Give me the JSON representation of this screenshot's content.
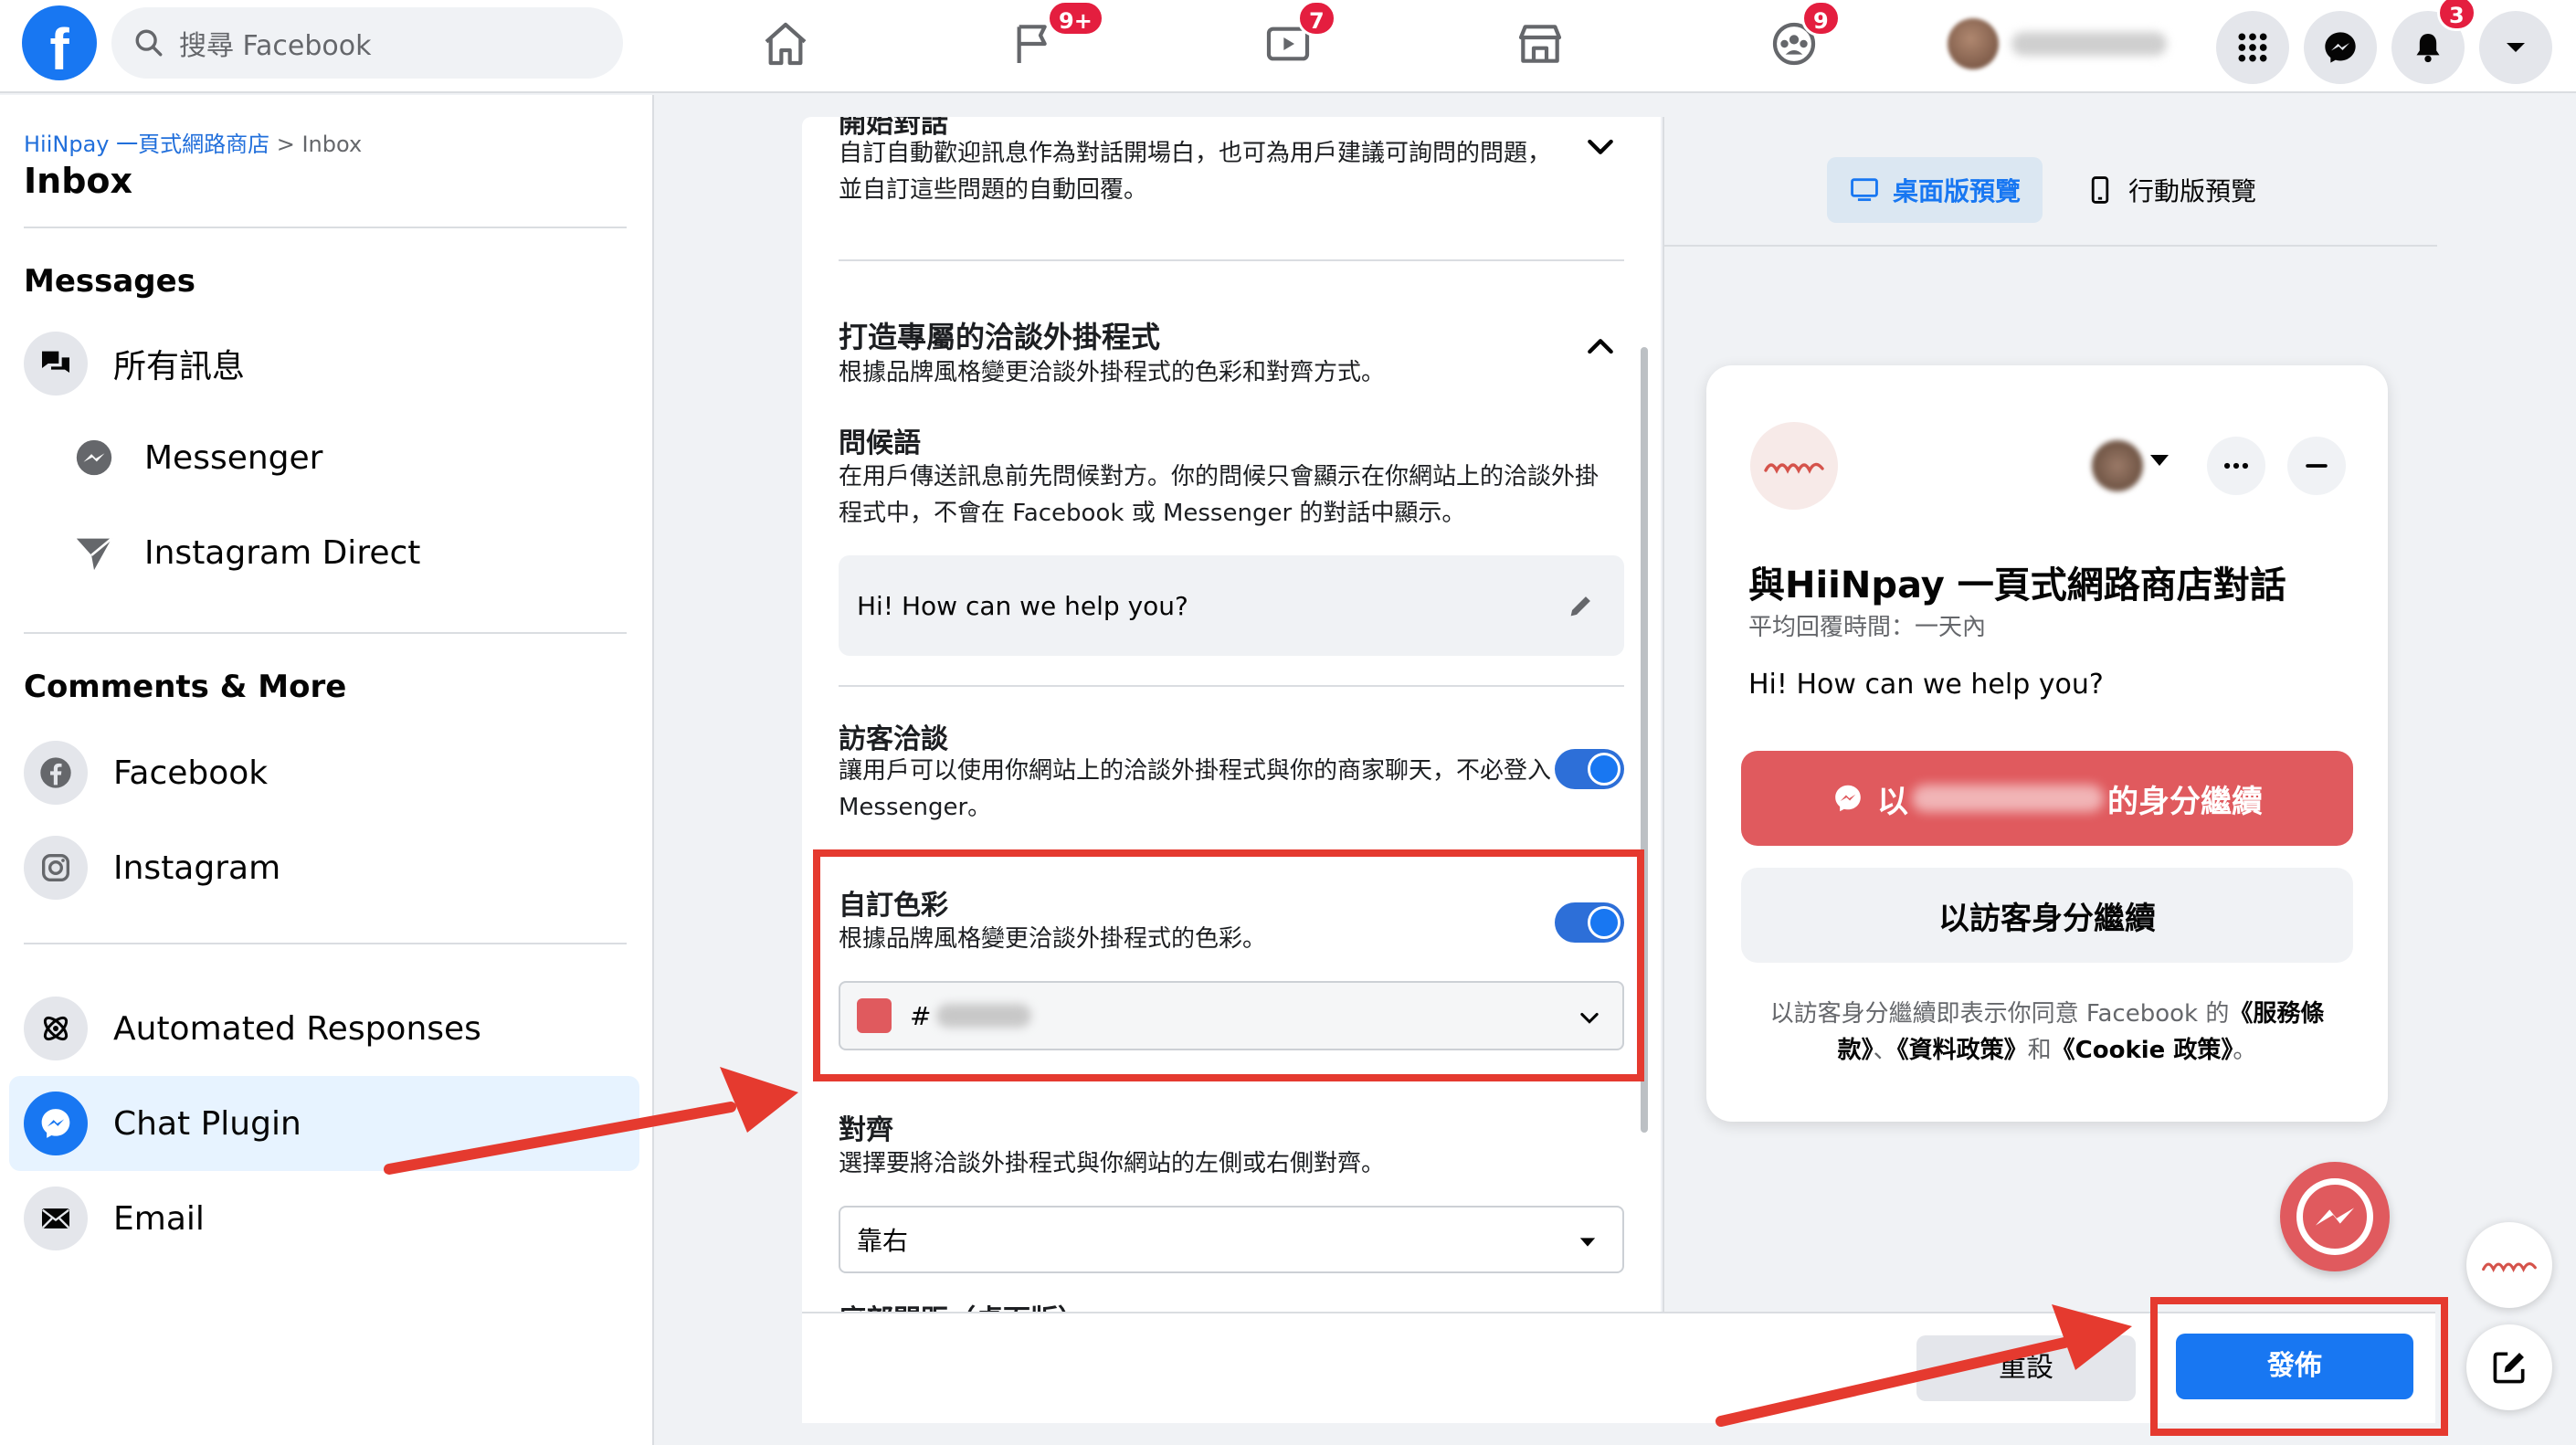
{
  "topbar": {
    "logo_letter": "f",
    "search_placeholder": "搜尋 Facebook",
    "badges": {
      "pages": "9+",
      "watch": "7",
      "groups": "9",
      "notifications": "3"
    }
  },
  "sidebar": {
    "breadcrumb_link": "HiiNpay 一頁式網路商店",
    "breadcrumb_rest": " > Inbox",
    "title": "Inbox",
    "messages_title": "Messages",
    "all_messages": "所有訊息",
    "messenger": "Messenger",
    "instagram_direct": "Instagram Direct",
    "comments_title": "Comments & More",
    "facebook": "Facebook",
    "instagram": "Instagram",
    "automated": "Automated Responses",
    "chat_plugin": "Chat Plugin",
    "email": "Email"
  },
  "settings": {
    "start_conv_title": "開始對話",
    "start_conv_desc": "自訂自動歡迎訊息作為對話開場白，也可為用戶建議可詢問的問題，並自訂這些問題的自動回覆。",
    "build_title": "打造專屬的洽談外掛程式",
    "build_desc": "根據品牌風格變更洽談外掛程式的色彩和對齊方式。",
    "greeting_title": "問候語",
    "greeting_desc": "在用戶傳送訊息前先問候對方。你的問候只會顯示在你網站上的洽談外掛程式中，不會在 Facebook 或 Messenger 的對話中顯示。",
    "greeting_value": "Hi! How can we help you?",
    "guest_title": "訪客洽談",
    "guest_desc": "讓用戶可以使用你網站上的洽談外掛程式與你的商家聊天，不必登入 Messenger。",
    "color_title": "自訂色彩",
    "color_desc": "根據品牌風格變更洽談外掛程式的色彩。",
    "color_value": "#",
    "color_swatch": "#e05a5e",
    "align_title": "對齊",
    "align_desc": "選擇要將洽談外掛程式與你網站的左側或右側對齊。",
    "align_value": "靠右",
    "next_section": "底部間距（桌面版）",
    "reset_label": "重設",
    "publish_label": "發佈"
  },
  "preview": {
    "desktop_tab": "桌面版預覽",
    "mobile_tab": "行動版預覽",
    "title": "與HiiNpay 一頁式網路商店對話",
    "reply_time": "平均回覆時間：一天內",
    "greeting": "Hi! How can we help you?",
    "continue_prefix": "以",
    "continue_suffix": "的身分繼續",
    "guest_continue": "以訪客身分繼續",
    "legal_1": "以訪客身分繼續即表示你同意 Facebook 的",
    "legal_terms": "《服務條款》",
    "legal_2": "、",
    "legal_data": "《資料政策》",
    "legal_3": "和",
    "legal_cookie": "《Cookie 政策》",
    "legal_4": "。"
  },
  "colors": {
    "accent": "#1877f2",
    "brand": "#e05a5e",
    "annotation": "#e53a2f"
  }
}
